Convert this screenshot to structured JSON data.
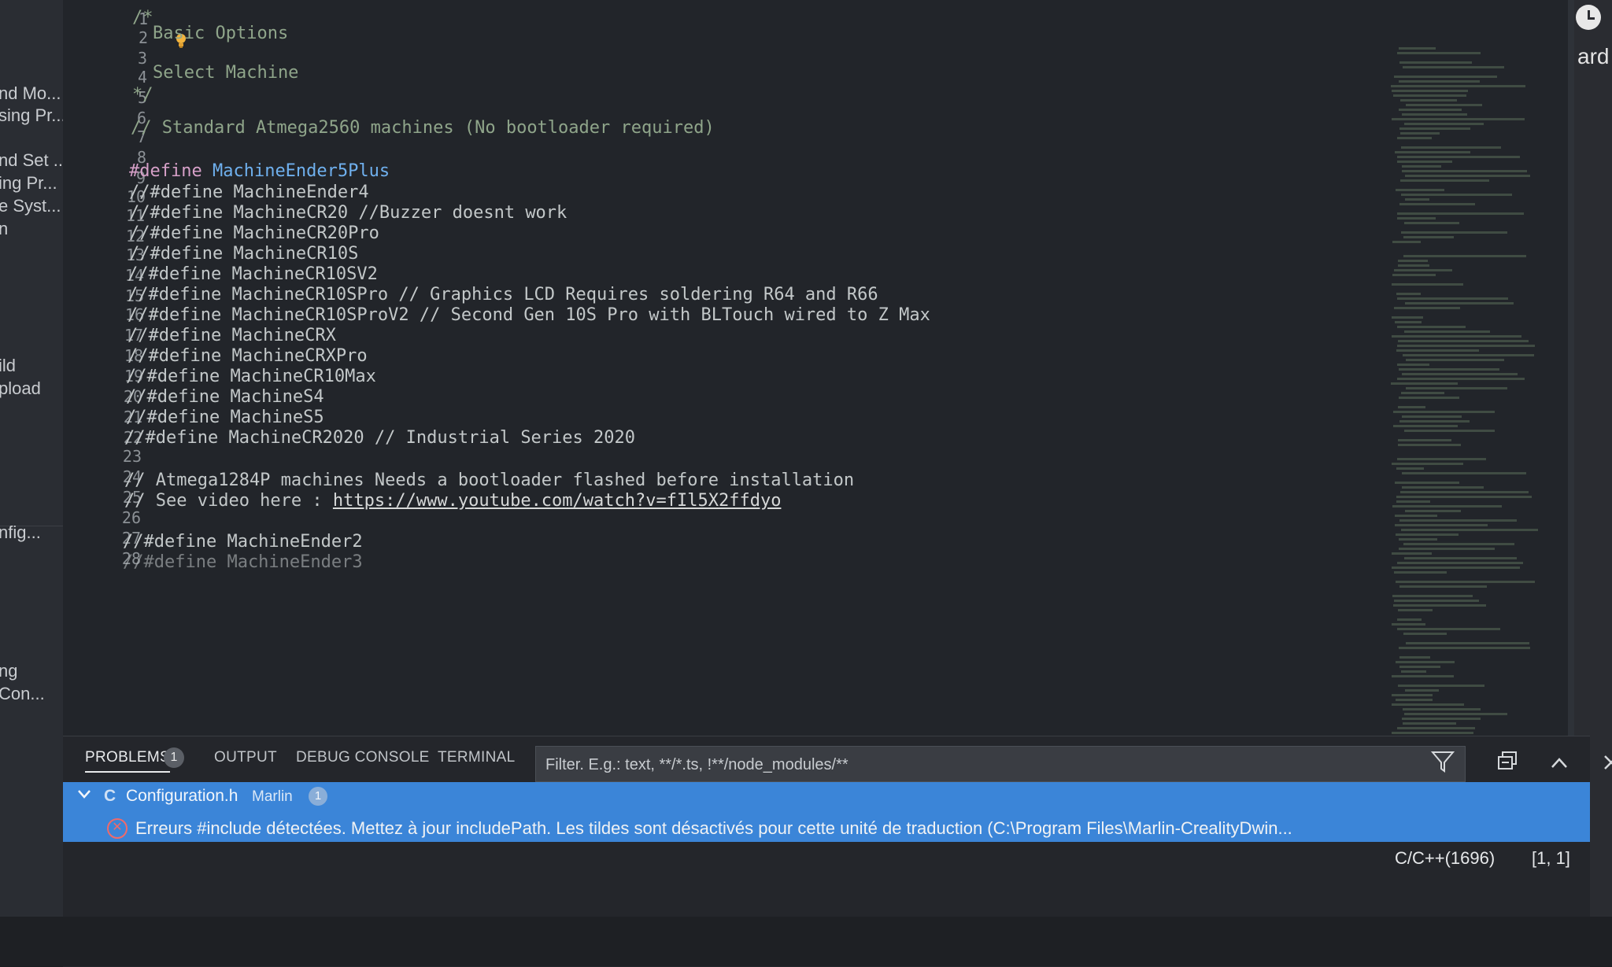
{
  "sidebar": {
    "items": [
      "nd Mo...",
      "sing Pr...",
      "nd Set ...",
      "ing Pr...",
      "e Syst...",
      "n",
      "ild",
      "pload",
      "nfig...",
      "ng",
      "Con..."
    ]
  },
  "editor": {
    "line_numbers": [
      "1",
      "2",
      "3",
      "4",
      "5",
      "6",
      "7",
      "8",
      "9",
      "10",
      "11",
      "12",
      "13",
      "14",
      "15",
      "16",
      "17",
      "18",
      "19",
      "20",
      "21",
      "22",
      "23",
      "24",
      "25",
      "26",
      "27",
      "28"
    ],
    "lines": {
      "l1": "/*",
      "l2": "Basic Options",
      "l4": "Select Machine",
      "l5": "*/",
      "l7": "// Standard Atmega2560 machines (No bootloader required)",
      "l9_kw": "#define",
      "l9_name": "MachineEnder5Plus",
      "l10": "//#define MachineEnder4",
      "l11": "//#define MachineCR20 //Buzzer doesnt work",
      "l12": "//#define MachineCR20Pro",
      "l13": "//#define MachineCR10S",
      "l14": "//#define MachineCR10SV2",
      "l15": "//#define MachineCR10SPro // Graphics LCD Requires soldering R64 and R66",
      "l16": "//#define MachineCR10SProV2 // Second Gen 10S Pro with BLTouch wired to Z Max",
      "l17": "//#define MachineCRX",
      "l18": "//#define MachineCRXPro",
      "l19": "//#define MachineCR10Max",
      "l20": "//#define MachineS4",
      "l21": "//#define MachineS5",
      "l22": "//#define MachineCR2020 // Industrial Series 2020",
      "l24": "// Atmega1284P machines Needs a bootloader flashed before installation",
      "l25_prefix": "// See video here : ",
      "l25_link": "https://www.youtube.com/watch?v=fIl5X2ffdyo",
      "l27": "//#define MachineEnder2",
      "l28": "//#define MachineEnder3"
    }
  },
  "right_panel": {
    "text": "ard"
  },
  "panel": {
    "tabs": {
      "problems": "PROBLEMS",
      "output": "OUTPUT",
      "debug_console": "DEBUG CONSOLE",
      "terminal": "TERMINAL"
    },
    "problems_count": "1",
    "filter_placeholder": "Filter. E.g.: text, **/*.ts, !**/node_modules/**",
    "file": {
      "name": "Configuration.h",
      "folder": "Marlin",
      "count": "1"
    },
    "error": {
      "message": "Erreurs #include détectées. Mettez à jour includePath. Les tildes sont désactivés pour cette unité de traduction (C:\\Program Files\\Marlin-CrealityDwin...",
      "source": "C/C++(1696)",
      "position": "[1, 1]"
    }
  },
  "colors": {
    "accent": "#3b85d8",
    "comment": "#8fa58a",
    "keyword": "#d6a0c8",
    "identifier": "#6fb0ee",
    "error": "#f06a6a"
  }
}
